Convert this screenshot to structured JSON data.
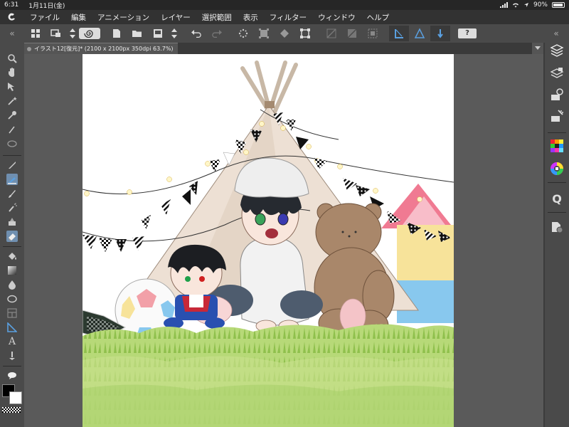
{
  "status_bar": {
    "time": "6:31",
    "date": "1月11日(金)",
    "battery": "90%",
    "battery_level": 0.9
  },
  "app": {
    "logo_icon": "clip-studio-logo-icon",
    "menu": [
      "ファイル",
      "編集",
      "アニメーション",
      "レイヤー",
      "選択範囲",
      "表示",
      "フィルター",
      "ウィンドウ",
      "ヘルプ"
    ]
  },
  "command_bar": {
    "buttons": [
      "layout-grid-icon",
      "transform-icon",
      "swap-arrows-icon",
      "spiral-icon",
      "new-file-icon",
      "open-folder-icon",
      "save-icon",
      "swap-arrows-icon",
      "undo-icon",
      "redo-icon",
      "sparkle-icon",
      "cube-select-icon",
      "bucket-icon",
      "transform-handles-icon",
      "crop-icon",
      "fill-square-icon",
      "deselect-icon",
      "ruler-snap-icon",
      "perspective-icon",
      "vanish-point-icon",
      "help-icon"
    ],
    "help_label": "?"
  },
  "document_tab": {
    "title": "イラスト12[復元]* (2100 x 2100px 350dpi 63.7%)"
  },
  "left_toolbar": {
    "tools": [
      "zoom-icon",
      "hand-icon",
      "move-layer-icon",
      "magic-wand-icon",
      "eyedropper-icon",
      "lasso-icon",
      "pen-icon",
      "pencil-icon",
      "brush-icon",
      "airbrush-icon",
      "decoration-icon",
      "eraser-icon",
      "fill-icon",
      "gradient-icon",
      "blend-icon",
      "ellipse-icon",
      "frame-icon",
      "ruler-icon",
      "text-icon",
      "correction-icon",
      "balloon-icon"
    ],
    "selected_tool": "eraser-icon",
    "text_tool_label": "A",
    "main_color": "#000000",
    "sub_color": "#ffffff"
  },
  "right_toolbar": {
    "tools": [
      "layer-icon",
      "layer-property-icon",
      "sub-tool-icon",
      "tool-property-icon",
      "color-set-icon",
      "color-wheel-icon",
      "search-icon",
      "material-icon"
    ],
    "search_label": "Q"
  },
  "colors": {
    "ui_dark": "#323232",
    "ui_mid": "#4a4a4a",
    "canvas_bg": "#5a5a5a",
    "accent": "#6f8fb0",
    "grass": "#a8d06a",
    "tent": "#ede0d4"
  }
}
